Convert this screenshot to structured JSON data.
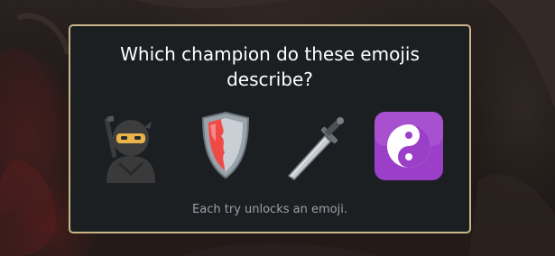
{
  "quiz": {
    "question": "Which champion do these emojis describe?",
    "hint": "Each try unlocks an emoji."
  },
  "emojis": [
    {
      "icon": "ninja-icon"
    },
    {
      "icon": "shield-icon"
    },
    {
      "icon": "dagger-icon"
    },
    {
      "icon": "yin-yang-icon"
    }
  ],
  "colors": {
    "panel_background": "#1c1f22",
    "panel_border": "#c9b48a",
    "title_text": "#ffffff",
    "hint_text": "#9aa0a6"
  }
}
